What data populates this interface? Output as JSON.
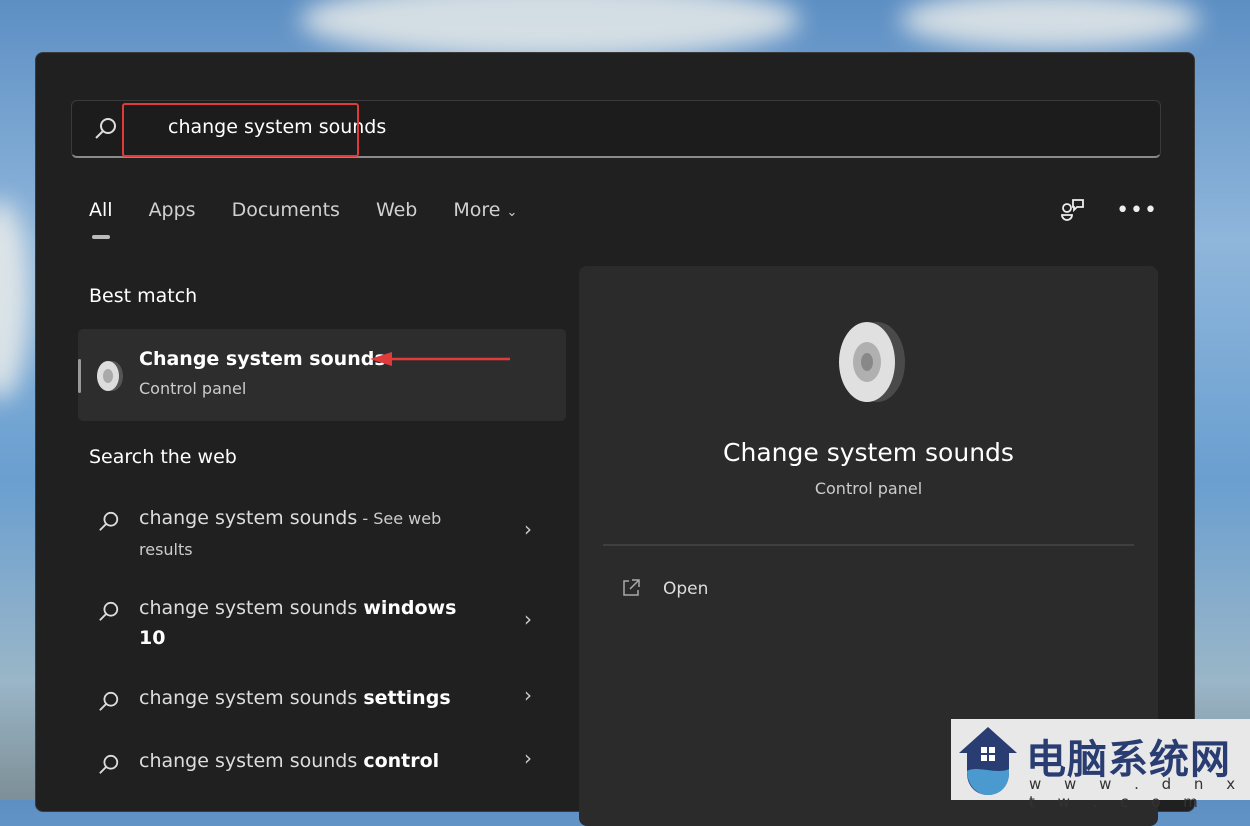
{
  "search": {
    "value": "change system sounds"
  },
  "tabs": [
    {
      "label": "All"
    },
    {
      "label": "Apps"
    },
    {
      "label": "Documents"
    },
    {
      "label": "Web"
    },
    {
      "label": "More"
    }
  ],
  "best_match": {
    "heading": "Best match",
    "title": "Change system sounds",
    "subtitle": "Control panel"
  },
  "web": {
    "heading": "Search the web",
    "items": [
      {
        "prefix": "change system sounds",
        "bold": "",
        "suffix": " - See web results"
      },
      {
        "prefix": "change system sounds ",
        "bold": "windows 10",
        "suffix": ""
      },
      {
        "prefix": "change system sounds ",
        "bold": "settings",
        "suffix": ""
      },
      {
        "prefix": "change system sounds ",
        "bold": "control",
        "suffix": ""
      }
    ]
  },
  "detail": {
    "title": "Change system sounds",
    "subtitle": "Control panel",
    "open_label": "Open"
  },
  "watermark": {
    "text": "电脑系统网",
    "url": "w w w . d n x t w . c o m"
  },
  "colors": {
    "highlight": "#e03a3a",
    "panel": "#202020"
  }
}
